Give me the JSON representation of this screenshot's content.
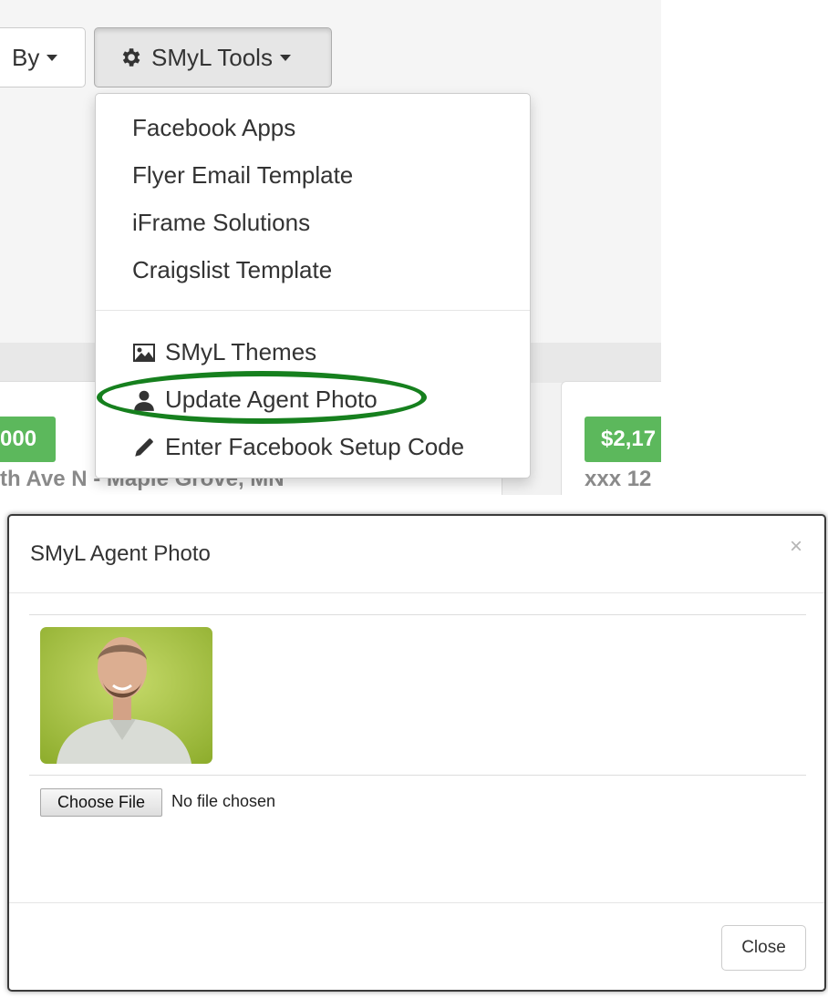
{
  "toolbar": {
    "sort_button_label": "By",
    "tools_button_label": "SMyL Tools"
  },
  "dropdown": {
    "items": [
      {
        "label": "Facebook Apps",
        "icon": ""
      },
      {
        "label": "Flyer Email Template",
        "icon": ""
      },
      {
        "label": "iFrame Solutions",
        "icon": ""
      },
      {
        "label": "Craigslist Template",
        "icon": ""
      },
      {
        "label": "SMyL Themes",
        "icon": "picture-icon"
      },
      {
        "label": "Update Agent Photo",
        "icon": "user-icon",
        "highlighted": true
      },
      {
        "label": "Enter Facebook Setup Code",
        "icon": "pencil-icon"
      }
    ]
  },
  "listings": [
    {
      "price": "000",
      "address": "th Ave N - Maple Grove, MN"
    },
    {
      "price": "$2,17",
      "address": "xxx 12"
    }
  ],
  "modal": {
    "title": "SMyL Agent Photo",
    "close_x": "×",
    "file_button_label": "Choose File",
    "file_status": "No file chosen",
    "close_button_label": "Close"
  },
  "colors": {
    "price_badge": "#5cb85c",
    "highlight_ring": "#16801e"
  }
}
